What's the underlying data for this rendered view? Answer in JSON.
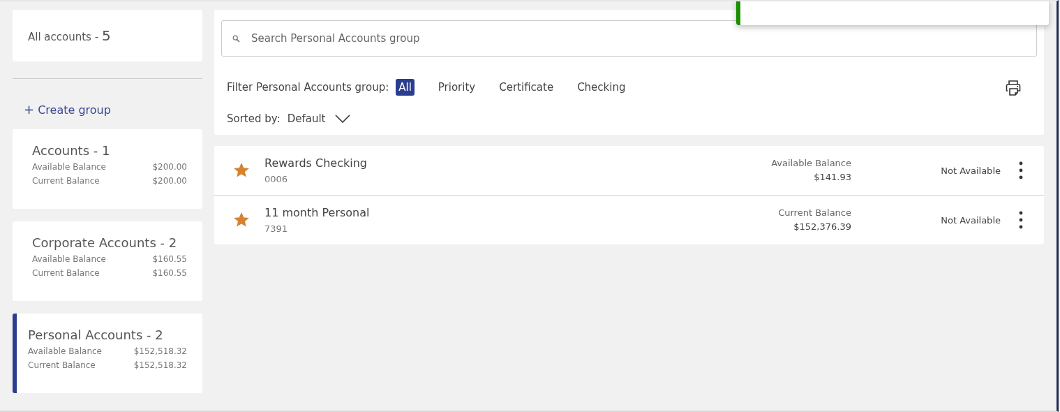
{
  "all_accounts": {
    "label": "All accounts - ",
    "count": "5"
  },
  "create_group": {
    "icon": "+",
    "label": "Create group"
  },
  "groups": [
    {
      "title": "Accounts - 1",
      "selected": false,
      "lines": [
        {
          "label": "Available Balance",
          "amount": "$200.00"
        },
        {
          "label": "Current Balance",
          "amount": "$200.00"
        }
      ]
    },
    {
      "title": "Corporate Accounts - 2",
      "selected": false,
      "lines": [
        {
          "label": "Available Balance",
          "amount": "$160.55"
        },
        {
          "label": "Current Balance",
          "amount": "$160.55"
        }
      ]
    },
    {
      "title": "Personal Accounts - 2",
      "selected": true,
      "lines": [
        {
          "label": "Available Balance",
          "amount": "$152,518.32"
        },
        {
          "label": "Current Balance",
          "amount": "$152,518.32"
        }
      ]
    }
  ],
  "search": {
    "placeholder": "Search Personal Accounts group"
  },
  "filter": {
    "label": "Filter Personal Accounts group:",
    "options": [
      {
        "label": "All",
        "selected": true
      },
      {
        "label": "Priority",
        "selected": false
      },
      {
        "label": "Certificate",
        "selected": false
      },
      {
        "label": "Checking",
        "selected": false
      }
    ]
  },
  "sort": {
    "label": "Sorted by:",
    "value": "Default"
  },
  "accounts": [
    {
      "name": "Rewards Checking",
      "number": "0006",
      "favorite": true,
      "balance_label": "Available Balance",
      "balance": "$141.93",
      "status": "Not Available"
    },
    {
      "name": "11 month Personal",
      "number": "7391",
      "favorite": true,
      "balance_label": "Current Balance",
      "balance": "$152,376.39",
      "status": "Not Available"
    }
  ]
}
